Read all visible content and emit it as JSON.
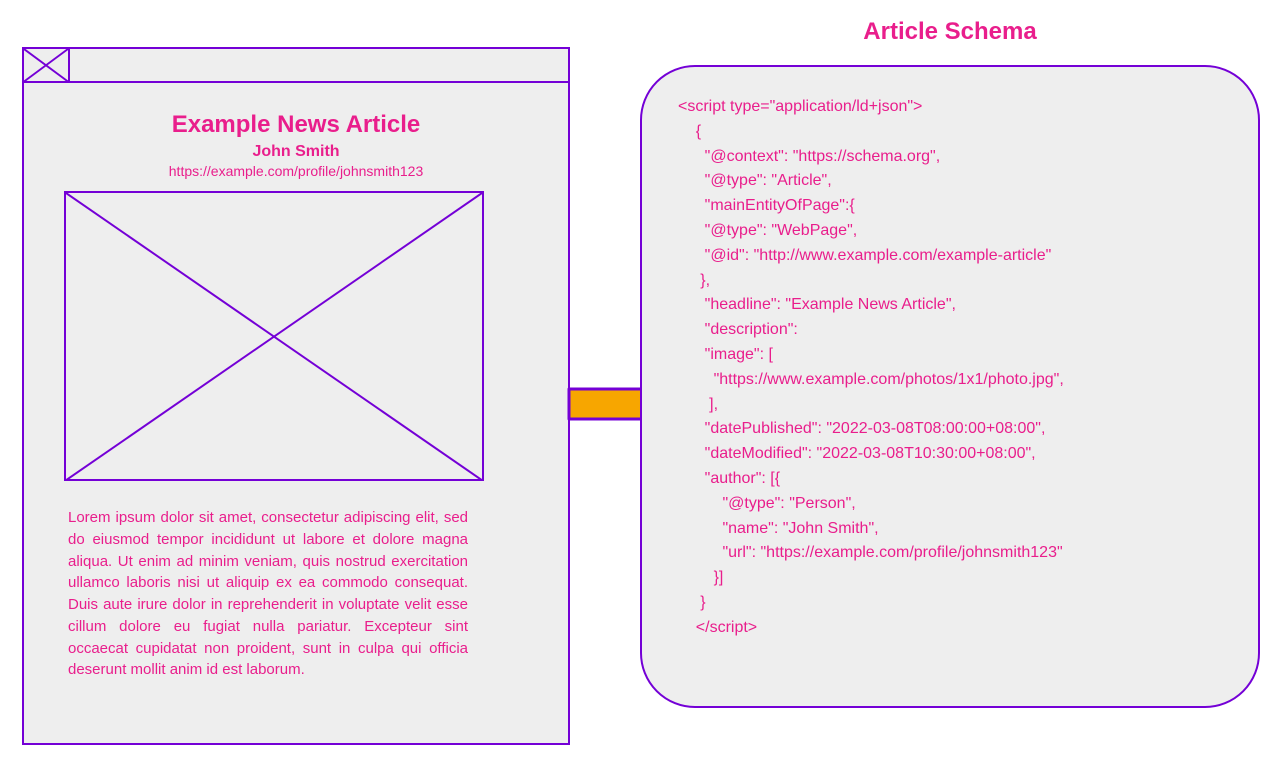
{
  "article": {
    "title": "Example News Article",
    "author": "John Smith",
    "author_url": "https://example.com/profile/johnsmith123",
    "body": "Lorem ipsum dolor sit amet, consectetur adipiscing elit, sed do eiusmod tempor incididunt ut labore et dolore magna aliqua. Ut enim ad minim veniam, quis nostrud exercitation ullamco laboris nisi ut aliquip ex ea commodo consequat. Duis aute irure dolor in reprehenderit in voluptate velit esse cillum dolore eu fugiat nulla pariatur. Excepteur sint occaecat cupidatat non proident, sunt in culpa qui officia deserunt mollit anim id est laborum."
  },
  "schema": {
    "title": "Article Schema",
    "lines": [
      "<script type=\"application/ld+json\">",
      "    {",
      "      \"@context\": \"https://schema.org\",",
      "      \"@type\": \"Article\",",
      "      \"mainEntityOfPage\":{",
      "      \"@type\": \"WebPage\",",
      "      \"@id\": \"http://www.example.com/example-article\"",
      "     },",
      "      \"headline\": \"Example News Article\",",
      "      \"description\":",
      "      \"image\": [",
      "        \"https://www.example.com/photos/1x1/photo.jpg\",",
      "       ],",
      "      \"datePublished\": \"2022-03-08T08:00:00+08:00\",",
      "      \"dateModified\": \"2022-03-08T10:30:00+08:00\",",
      "      \"author\": [{",
      "          \"@type\": \"Person\",",
      "          \"name\": \"John Smith\",",
      "          \"url\": \"https://example.com/profile/johnsmith123\"",
      "        }]",
      "     }",
      "    </script>"
    ]
  }
}
